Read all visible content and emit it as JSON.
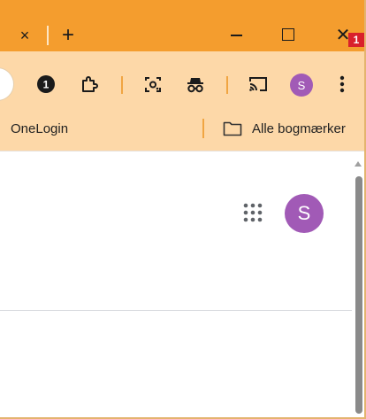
{
  "titlebar": {
    "tab_close": "×",
    "new_tab": "+",
    "window_close": "✕"
  },
  "toolbar": {
    "password_manager_badge": "1",
    "profile_initial": "S",
    "notification_count": "1",
    "icons": [
      "password-manager-icon",
      "extensions-icon",
      "lens-icon",
      "incognito-icon",
      "cast-icon",
      "more-menu-icon"
    ]
  },
  "bookmarks": {
    "items": [
      {
        "label": "OneLogin"
      },
      {
        "label": "Alle bogmærker"
      }
    ]
  },
  "content": {
    "account_initial": "S"
  },
  "colors": {
    "titlebar": "#f49d2e",
    "toolbar": "#fdd8a8",
    "profile": "#a15ab6",
    "badge": "#d9202b"
  }
}
